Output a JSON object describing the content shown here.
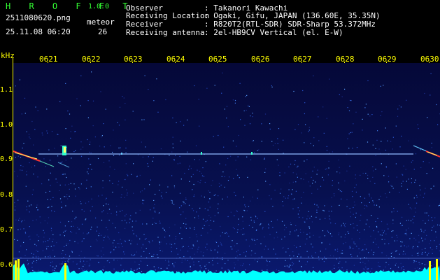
{
  "header": {
    "app_name": "H R O F F T",
    "version": "1.0.0",
    "filename": "2511080620.png",
    "meteor_label": "meteor",
    "datetime": "25.11.08 06:20",
    "meteor_count": "26",
    "info": [
      {
        "key": "Observer",
        "value": ": Takanori Kawachi"
      },
      {
        "key": "Receiving Location",
        "value": ": Ogaki, Gifu, JAPAN (136.60E, 35.35N)"
      },
      {
        "key": "Receiver",
        "value": ": R820T2(RTL-SDR) SDR-Sharp 53.372MHz"
      },
      {
        "key": "Receiving antenna",
        "value": ": 2el-HB9CV Vertical (el. E-W)"
      }
    ]
  },
  "axes": {
    "y_unit": "kHz",
    "y_ticks": [
      "1.1",
      "1.0",
      "0.9",
      "0.8",
      "0.7",
      "0.6"
    ],
    "x_ticks": [
      "0621",
      "0622",
      "0623",
      "0624",
      "0625",
      "0626",
      "0627",
      "0628",
      "0629",
      "0630"
    ]
  },
  "colors": {
    "background": "#000000",
    "spectrogram": "#060a4a",
    "axis": "#ffff00",
    "title": "#33ff33",
    "noise_floor": "#00ffff"
  }
}
